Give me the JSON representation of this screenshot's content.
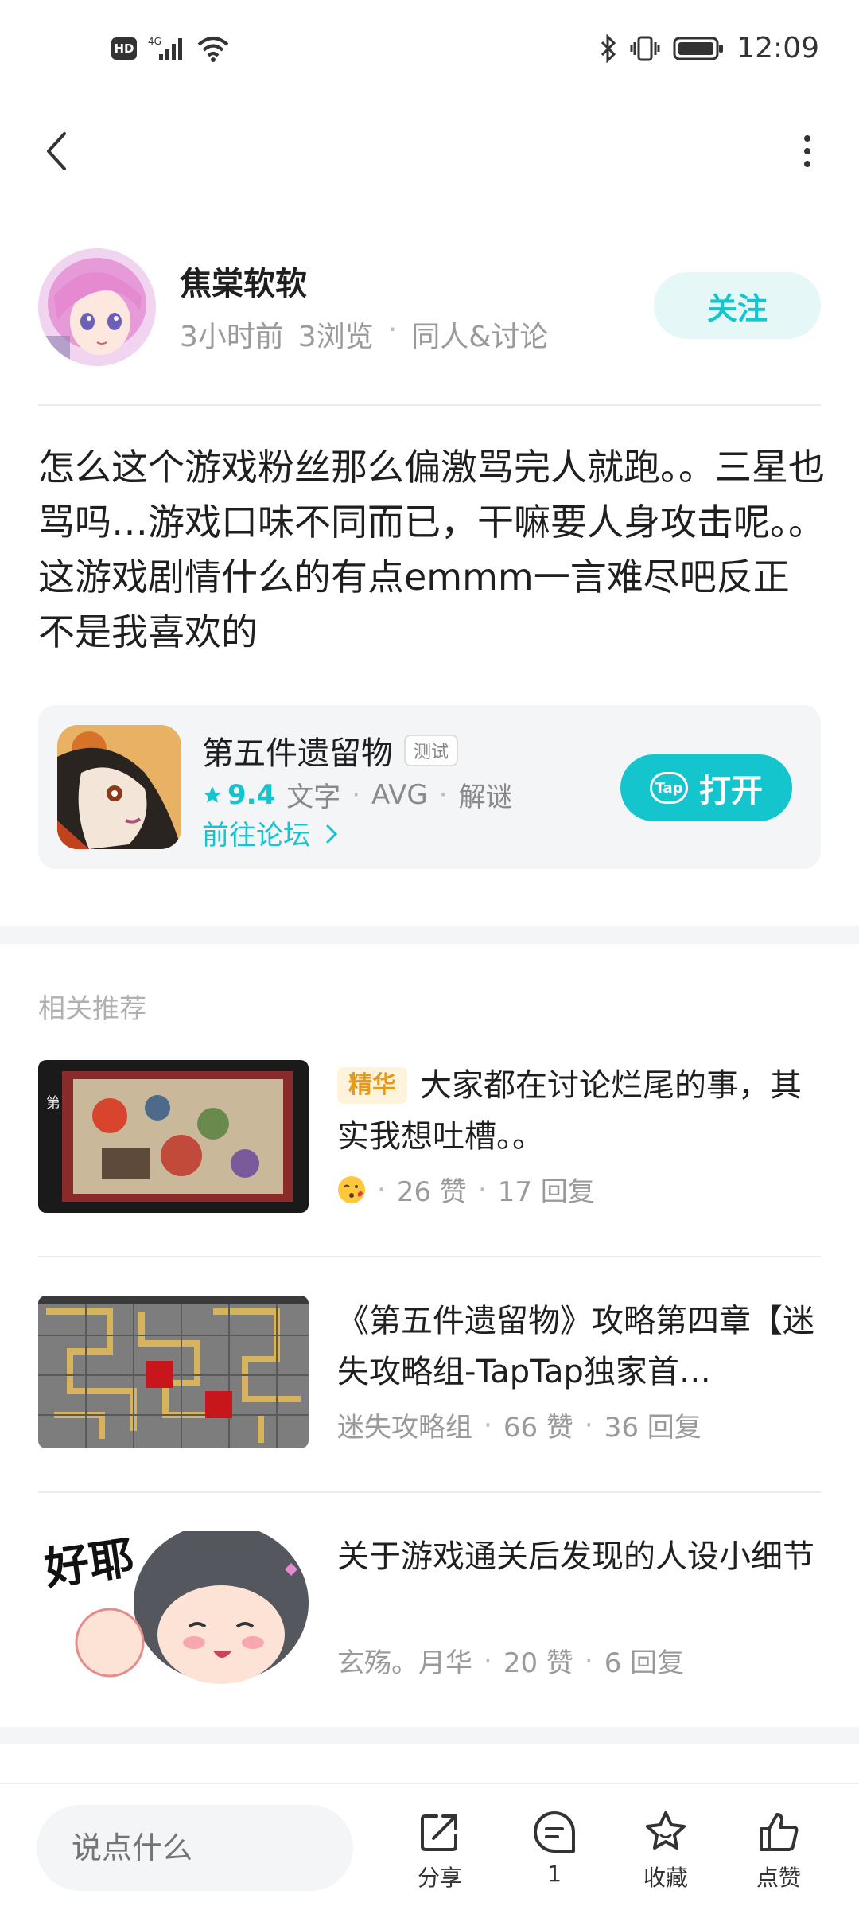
{
  "status_bar": {
    "hd": "HD",
    "network": "4G",
    "time": "12:09"
  },
  "post": {
    "author": "焦棠软软",
    "time_ago": "3小时前",
    "views": "3浏览",
    "category": "同人&讨论",
    "follow_label": "关注",
    "body": "怎么这个游戏粉丝那么偏激骂完人就跑。。三星也骂吗…游戏口味不同而已，干嘛要人身攻击呢。。这游戏剧情什么的有点emmm一言难尽吧反正不是我喜欢的"
  },
  "game_card": {
    "name": "第五件遗留物",
    "badge": "测试",
    "rating": "9.4",
    "tags": [
      "文字",
      "AVG",
      "解谜"
    ],
    "forum_link": "前往论坛",
    "open_label": "打开",
    "tap_logo": "Tap"
  },
  "recommendations": {
    "title": "相关推荐",
    "items": [
      {
        "badge": "精华",
        "title": "大家都在讨论烂尾的事，其实我想吐槽。。",
        "author": "",
        "likes": "26 赞",
        "replies": "17 回复"
      },
      {
        "badge": "",
        "title": "《第五件遗留物》攻略第四章【迷失攻略组-TapTap独家首…",
        "author": "迷失攻略组",
        "likes": "66 赞",
        "replies": "36 回复"
      },
      {
        "badge": "",
        "title": "关于游戏通关后发现的人设小细节",
        "author": "玄殇。月华",
        "likes": "20 赞",
        "replies": "6 回复"
      }
    ]
  },
  "bottom_bar": {
    "comment_placeholder": "说点什么",
    "share_label": "分享",
    "comment_count": "1",
    "favorite_label": "收藏",
    "like_label": "点赞"
  },
  "colors": {
    "accent": "#15c5ce",
    "badge_orange": "#e39a1d",
    "muted": "#9a9a9a"
  }
}
